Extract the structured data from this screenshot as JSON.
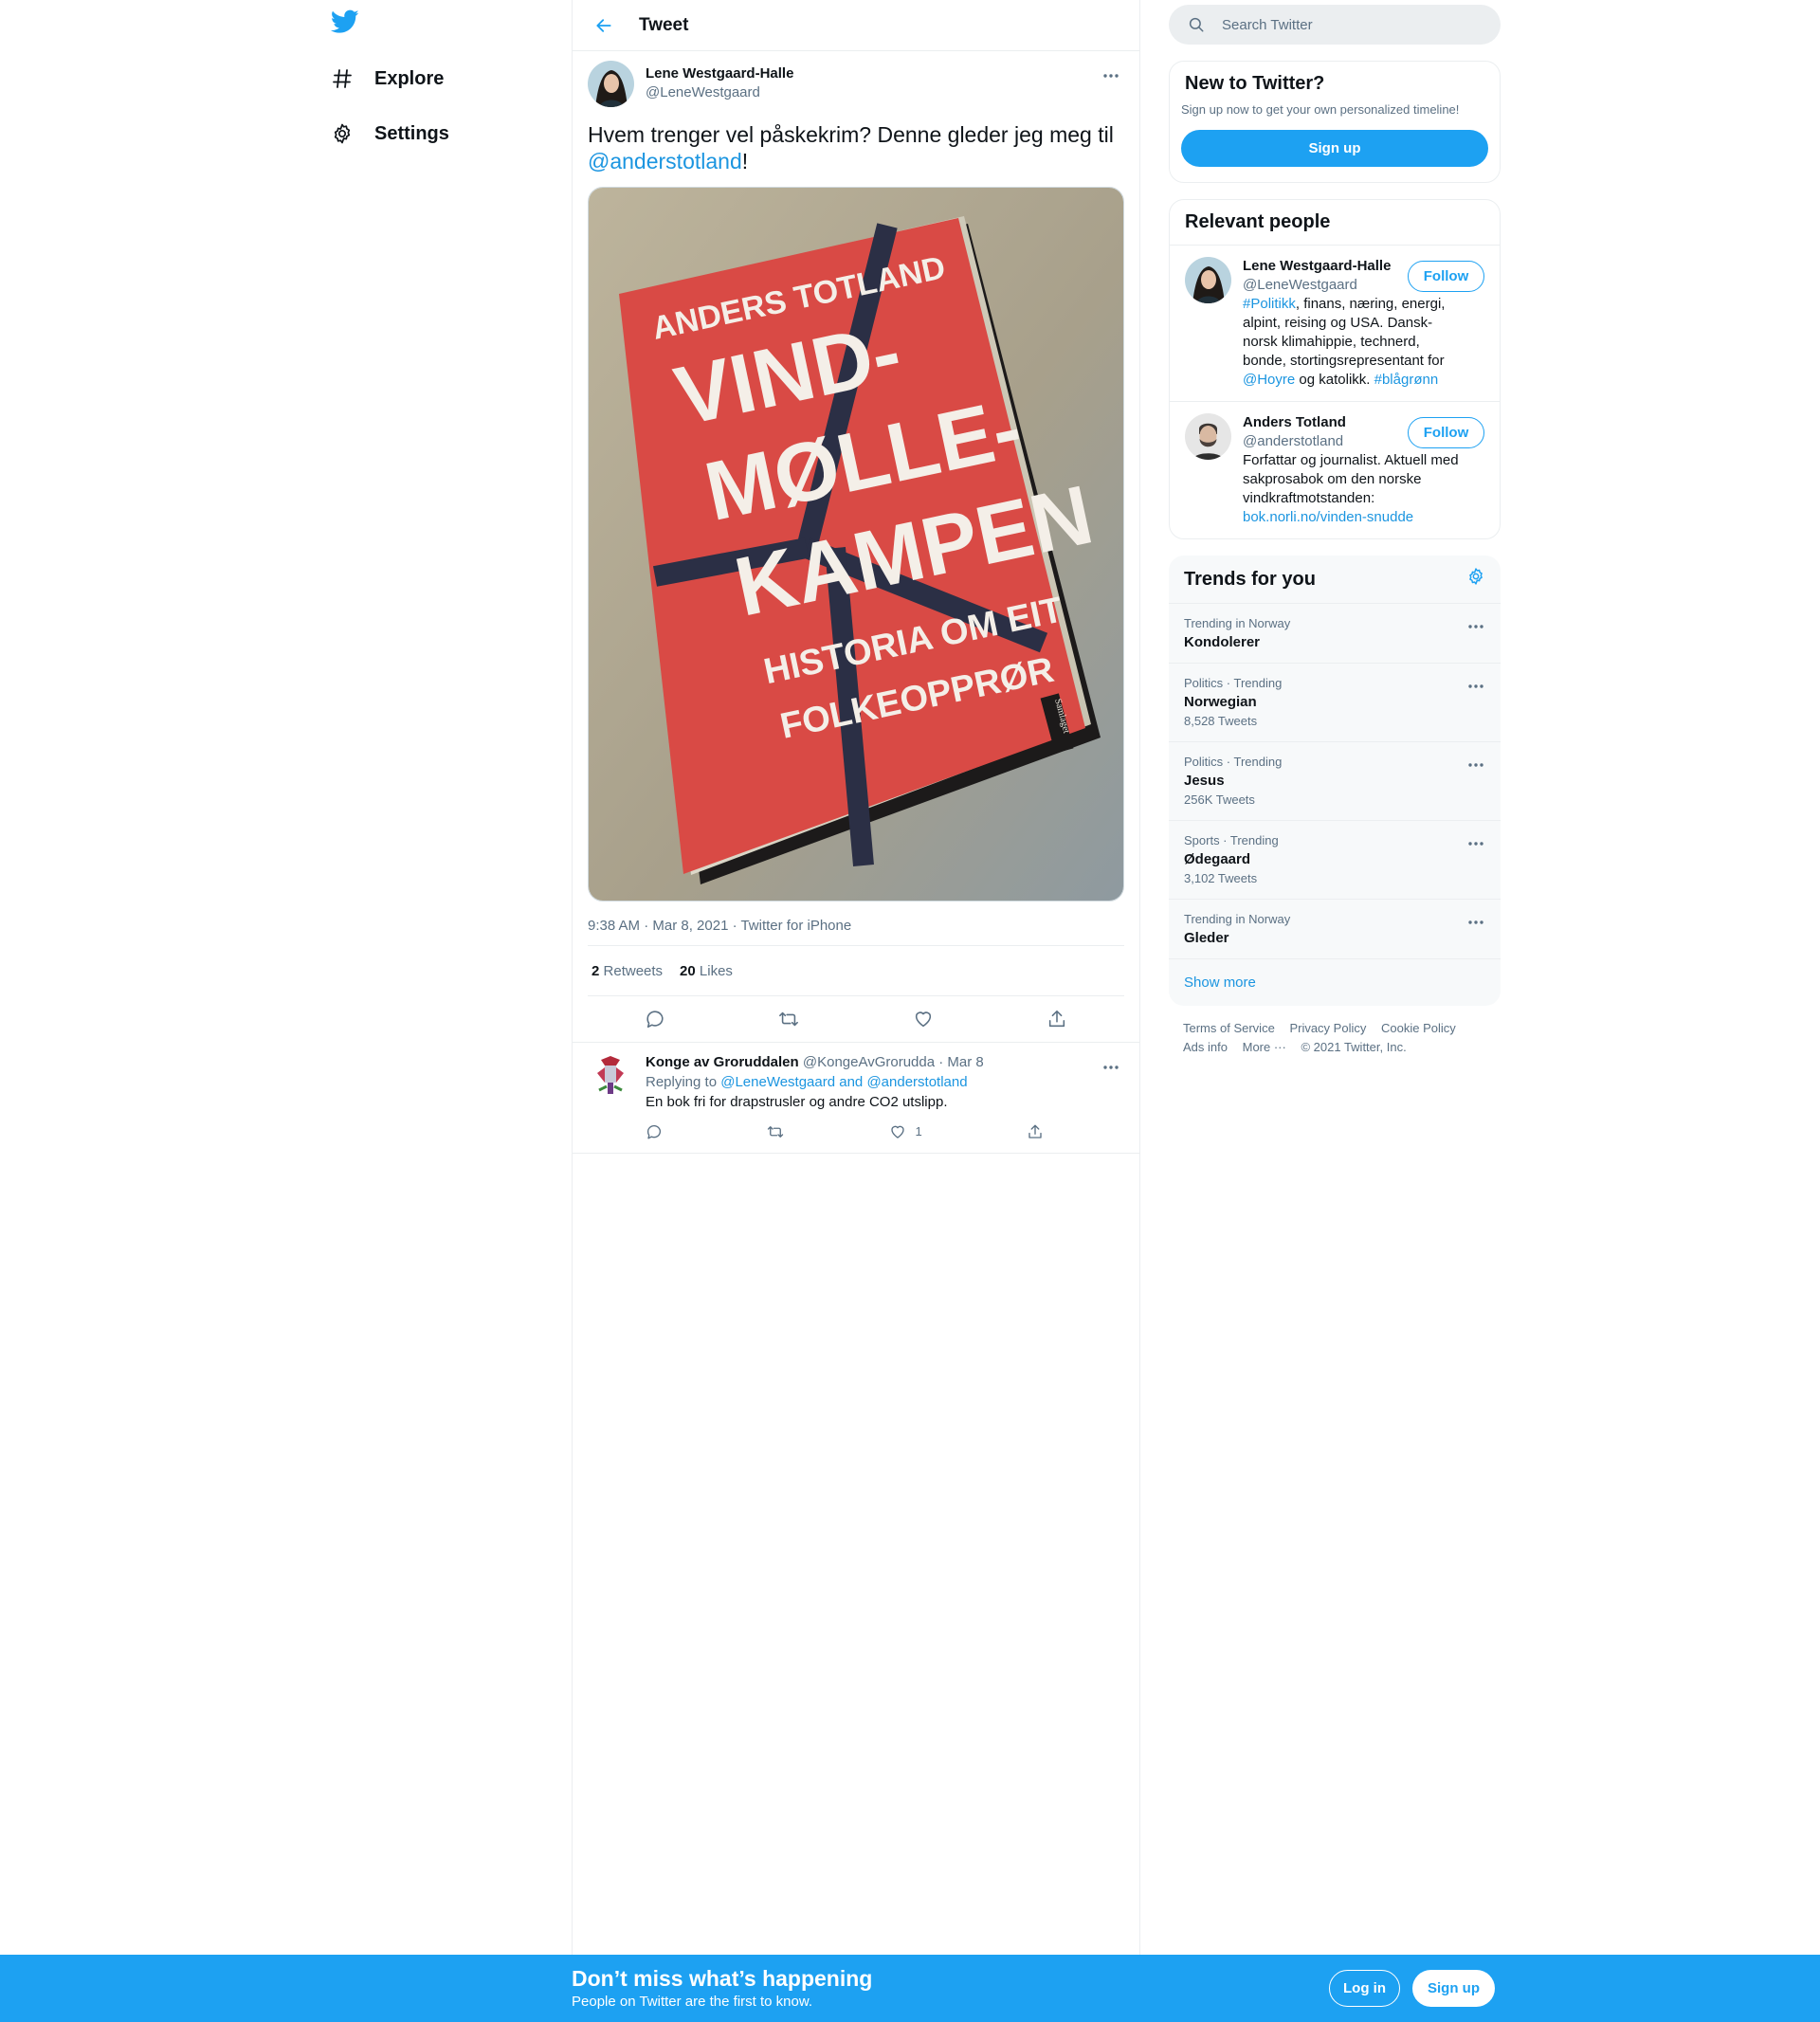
{
  "nav": {
    "items": [
      {
        "label": "Explore",
        "icon": "hashtag-icon"
      },
      {
        "label": "Settings",
        "icon": "gear-icon"
      }
    ]
  },
  "header": {
    "title": "Tweet"
  },
  "tweet": {
    "author_name": "Lene Westgaard-Halle",
    "author_handle": "@LeneWestgaard",
    "text_before": "Hvem trenger vel påskekrim? Denne gleder jeg meg til ",
    "mention": "@anderstotland",
    "text_after": "!",
    "image": {
      "author": "ANDERS TOTLAND",
      "title_lines": [
        "VIND-",
        "MØLLE-",
        "KAMPEN"
      ],
      "subtitle_lines": [
        "HISTORIA OM EIT",
        "FOLKEOPPRØR"
      ],
      "publisher": "Samlaget"
    },
    "meta": "9:38 AM · Mar 8, 2021 · Twitter for iPhone",
    "retweets_count": "2",
    "retweets_label": "Retweets",
    "likes_count": "20",
    "likes_label": "Likes"
  },
  "reply": {
    "author_name": "Konge av Groruddalen",
    "author_handle": "@KongeAvGrorudda",
    "date": "· Mar 8",
    "replying_to_label": "Replying to",
    "replying_to": "@LeneWestgaard and @anderstotland",
    "text": "En bok fri for drapstrusler og andre CO2 utslipp.",
    "likes": "1"
  },
  "search": {
    "placeholder": "Search Twitter"
  },
  "new_to_twitter": {
    "title": "New to Twitter?",
    "subtitle": "Sign up now to get your own personalized timeline!",
    "button": "Sign up"
  },
  "relevant_people": {
    "title": "Relevant people",
    "people": [
      {
        "name": "Lene Westgaard-Halle",
        "handle": "@LeneWestgaard",
        "follow": "Follow",
        "bio_parts": [
          "#Politikk",
          ", finans, næring, energi, alpint, reising og USA. Dansk-norsk klimahippie, technerd, bonde, stortingsrepresentant for ",
          "@Hoyre",
          " og katolikk. ",
          "#blågrønn"
        ]
      },
      {
        "name": "Anders Totland",
        "handle": "@anderstotland",
        "follow": "Follow",
        "bio": "Forfattar og journalist. Aktuell med sakprosabok om den norske vindkraftmotstanden: ",
        "bio_link": "bok.norli.no/vinden-snudde"
      }
    ]
  },
  "trends": {
    "title": "Trends for you",
    "items": [
      {
        "context": "Trending in Norway",
        "name": "Kondolerer",
        "count": ""
      },
      {
        "context": "Politics · Trending",
        "name": "Norwegian",
        "count": "8,528 Tweets"
      },
      {
        "context": "Politics · Trending",
        "name": "Jesus",
        "count": "256K Tweets"
      },
      {
        "context": "Sports · Trending",
        "name": "Ødegaard",
        "count": "3,102 Tweets"
      },
      {
        "context": "Trending in Norway",
        "name": "Gleder",
        "count": ""
      }
    ],
    "show_more": "Show more"
  },
  "footer": {
    "links": [
      "Terms of Service",
      "Privacy Policy",
      "Cookie Policy",
      "Ads info",
      "More ···"
    ],
    "copyright": "© 2021 Twitter, Inc."
  },
  "bottom_bar": {
    "headline": "Don’t miss what’s happening",
    "subline": "People on Twitter are the first to know.",
    "login": "Log in",
    "signup": "Sign up"
  },
  "colors": {
    "brand": "#1da1f2",
    "link": "#1b95e0",
    "muted": "#5b7083",
    "book_red": "#d94a45"
  }
}
